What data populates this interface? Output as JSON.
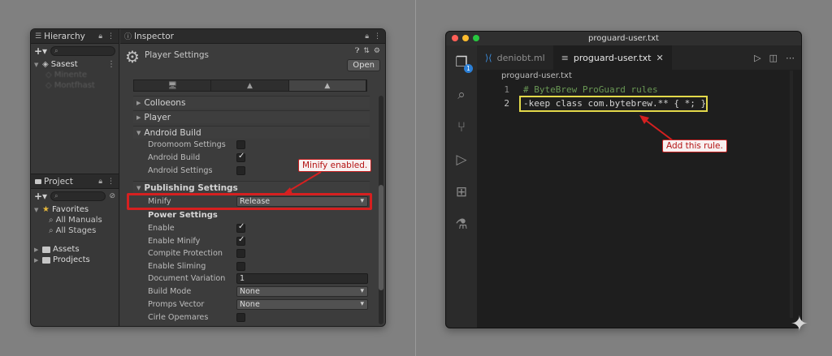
{
  "unity": {
    "hierarchy": {
      "tab_label": "Hierarchy",
      "search_placeholder": "",
      "scene_name": "Sasest",
      "children": [
        "Minente",
        "Montfhast"
      ]
    },
    "project": {
      "tab_label": "Project",
      "favorites_label": "Favorites",
      "favorites_items": [
        "All Manuals",
        "All Stages"
      ],
      "folders": [
        "Assets",
        "Prodjects"
      ]
    },
    "inspector": {
      "tab_label": "Inspector",
      "title": "Player Settings",
      "open_button": "Open",
      "foldouts": {
        "collections": "Colloeons",
        "player": "Player"
      },
      "android_build": {
        "header": "Android Build",
        "rows": [
          {
            "label": "Droomoom Settings",
            "checked": false
          },
          {
            "label": "Android Build",
            "checked": true
          },
          {
            "label": "Android Settings",
            "checked": false
          }
        ]
      },
      "publishing": {
        "header": "Publishing Settings",
        "minify_label": "Minify",
        "minify_value": "Release",
        "power_header": "Power Settings",
        "rows": [
          {
            "label": "Enable",
            "checked": true
          },
          {
            "label": "Enable Minify",
            "checked": true
          },
          {
            "label": "Compite Protection",
            "checked": false
          },
          {
            "label": "Enable Sliming",
            "checked": false
          }
        ],
        "document_variation_label": "Document Variation",
        "document_variation_value": "1",
        "build_mode_label": "Build Mode",
        "build_mode_value": "None",
        "promps_vector_label": "Promps Vector",
        "promps_vector_value": "None",
        "cirle_opemares_label": "Cirle Opemares",
        "cirle_opemares_checked": false
      },
      "callout": "Minify enabled."
    }
  },
  "vscode": {
    "window_title": "proguard-user.txt",
    "tabs": [
      {
        "label": "deniobt.ml",
        "active": false
      },
      {
        "label": "proguard-user.txt",
        "active": true
      }
    ],
    "breadcrumb": "proguard-user.txt",
    "source_control_badge": "1",
    "lines": [
      {
        "number": "1",
        "text": "# ByteBrew ProGuard rules"
      },
      {
        "number": "2",
        "text": "-keep class com.bytebrew.** { *; }"
      }
    ],
    "callout": "Add this rule."
  },
  "colors": {
    "highlight_red": "#d62020",
    "highlight_yellow": "#e3d94a",
    "vscode_badge": "#2b7fd6"
  }
}
